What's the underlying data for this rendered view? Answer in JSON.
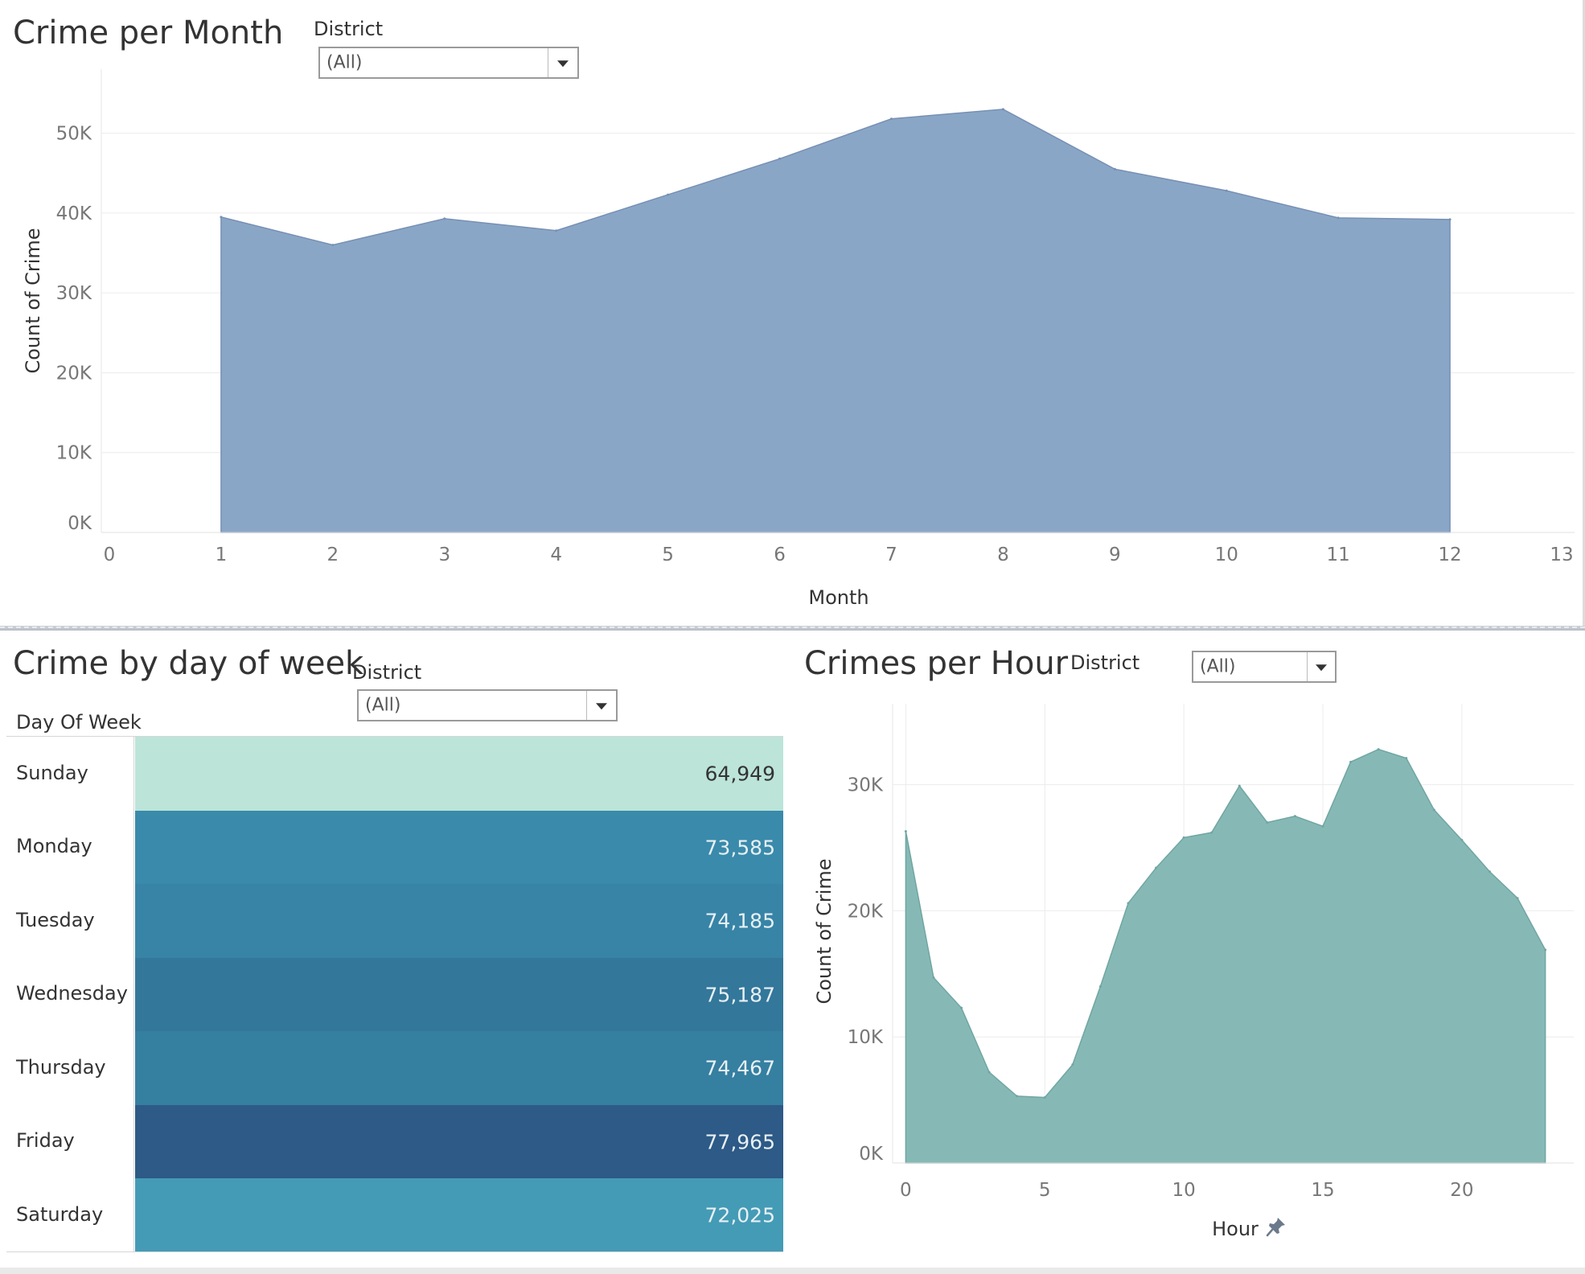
{
  "month_panel": {
    "title": "Crime per Month",
    "filter_label": "District",
    "filter_value": "(All)"
  },
  "dow_panel": {
    "title": "Crime by day of week",
    "filter_label": "District",
    "filter_value": "(All)",
    "row_header": "Day Of Week"
  },
  "hour_panel": {
    "title": "Crimes per Hour",
    "filter_label": "District",
    "filter_value": "(All)",
    "pin_icon": "pin-icon"
  },
  "colors": {
    "month_fill": "#8aa6c6",
    "month_stroke": "#7790b4",
    "hour_fill": "#86b9b5",
    "hour_stroke": "#70a6a2",
    "grid": "#ececec"
  },
  "chart_data": [
    {
      "type": "area",
      "title": "Crime per Month",
      "xlabel": "Month",
      "ylabel": "Count of Crime",
      "x": [
        1,
        2,
        3,
        4,
        5,
        6,
        7,
        8,
        9,
        10,
        11,
        12
      ],
      "values": [
        39500,
        36000,
        39300,
        37800,
        42300,
        46800,
        51800,
        53000,
        45500,
        42800,
        39400,
        39200
      ],
      "xlim": [
        0,
        13
      ],
      "ylim": [
        0,
        55000
      ],
      "xticks": [
        "0",
        "1",
        "2",
        "3",
        "4",
        "5",
        "6",
        "7",
        "8",
        "9",
        "10",
        "11",
        "12",
        "13"
      ],
      "yticks": [
        "0K",
        "10K",
        "20K",
        "30K",
        "40K",
        "50K"
      ],
      "grid": true
    },
    {
      "type": "heatmap",
      "title": "Crime by day of week",
      "row_header": "Day Of Week",
      "categories": [
        "Sunday",
        "Monday",
        "Tuesday",
        "Wednesday",
        "Thursday",
        "Friday",
        "Saturday"
      ],
      "values": [
        64949,
        73585,
        74185,
        75187,
        74467,
        77965,
        72025
      ],
      "labels": [
        "64,949",
        "73,585",
        "74,185",
        "75,187",
        "74,467",
        "77,965",
        "72,025"
      ],
      "cell_colors": [
        "#bce4d9",
        "#3a8aab",
        "#3784a7",
        "#33779a",
        "#357fa1",
        "#2d5a86",
        "#449bb6"
      ],
      "text_colors": [
        "#333333",
        "#e8f0f4",
        "#e8f0f4",
        "#e8f0f4",
        "#e8f0f4",
        "#e8f0f4",
        "#e8f0f4"
      ]
    },
    {
      "type": "area",
      "title": "Crimes per Hour",
      "xlabel": "Hour",
      "ylabel": "Count of Crime",
      "x": [
        0,
        1,
        2,
        3,
        4,
        5,
        6,
        7,
        8,
        9,
        10,
        11,
        12,
        13,
        14,
        15,
        16,
        17,
        18,
        19,
        20,
        21,
        22,
        23
      ],
      "values": [
        26300,
        14700,
        12300,
        7200,
        5300,
        5200,
        7800,
        14000,
        20600,
        23400,
        25800,
        26200,
        29900,
        27000,
        27500,
        26700,
        31800,
        32800,
        32100,
        28000,
        25600,
        23100,
        21000,
        16900
      ],
      "xlim": [
        -0.3,
        23.3
      ],
      "ylim": [
        0,
        34500
      ],
      "xticks": [
        "0",
        "5",
        "10",
        "15",
        "20"
      ],
      "yticks": [
        "0K",
        "10K",
        "20K",
        "30K"
      ],
      "grid": true
    }
  ]
}
